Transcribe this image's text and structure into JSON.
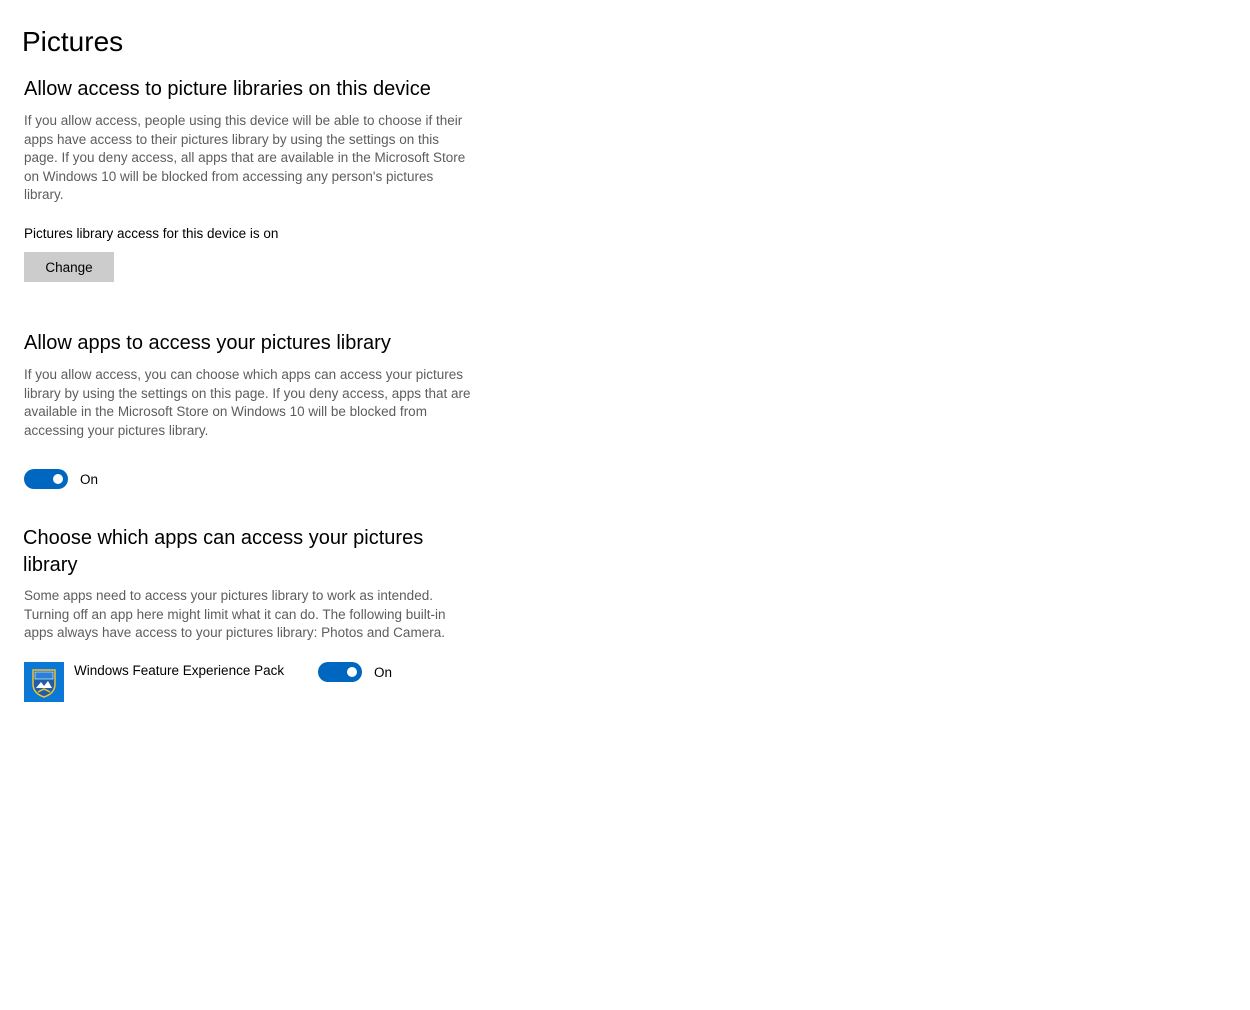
{
  "page": {
    "title": "Pictures"
  },
  "device_access": {
    "heading": "Allow access to picture libraries on this device",
    "description": "If you allow access, people using this device will be able to choose if their apps have access to their pictures library by using the settings on this page. If you deny access, all apps that are available in the Microsoft Store on Windows 10 will be blocked from accessing any person's pictures library.",
    "status": "Pictures library access for this device is on",
    "change_label": "Change"
  },
  "apps_access": {
    "heading": "Allow apps to access your pictures library",
    "description": "If you allow access, you can choose which apps can access your pictures library by using the settings on this page. If you deny access, apps that are available in the Microsoft Store on Windows 10 will be blocked from accessing your pictures library.",
    "toggle_state": "On"
  },
  "choose_apps": {
    "heading": "Choose which apps can access your pictures library",
    "description": "Some apps need to access your pictures library to work as intended. Turning off an app here might limit what it can do. The following built-in apps always have access to your pictures library: Photos and Camera.",
    "apps": [
      {
        "name": "Windows Feature Experience Pack",
        "toggle_state": "On",
        "icon": "windows-feature-experience-pack-icon"
      }
    ]
  },
  "colors": {
    "accent": "#0067c0",
    "button_bg": "#cccccc",
    "secondary_text": "#5d5d5d",
    "app_tile": "#0a78d4"
  }
}
